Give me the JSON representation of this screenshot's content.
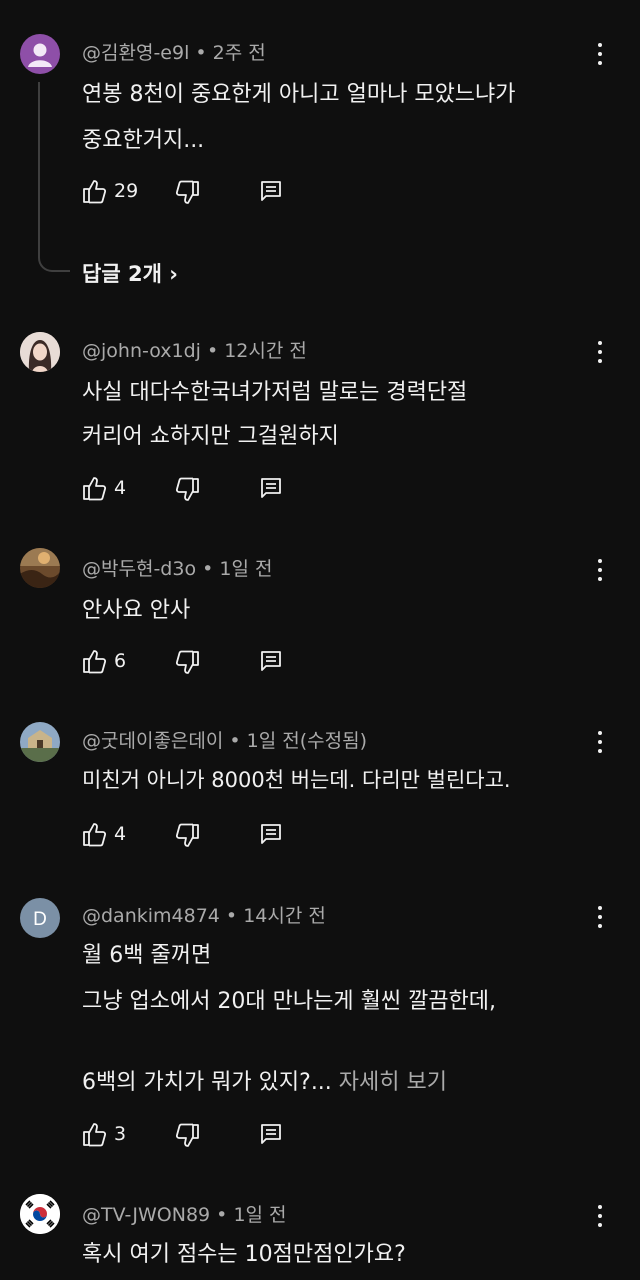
{
  "comments": [
    {
      "author": "@김환영-e9l",
      "time": "2주 전",
      "lines": [
        "연봉 8천이 중요한게 아니고 얼마나 모았느냐가",
        "중요한거지..."
      ],
      "likes": "29",
      "avatar": {
        "type": "default-person",
        "bg": "#8e4fa8"
      },
      "replies_label": "답글 2개 ›"
    },
    {
      "author": "@john-ox1dj",
      "time": "12시간 전",
      "lines": [
        "사실 대다수한국녀가저럼 말로는 경력단절",
        "커리어 쇼하지만 그걸원하지"
      ],
      "likes": "4",
      "avatar": {
        "type": "photo-portrait"
      }
    },
    {
      "author": "@박두현-d3o",
      "time": "1일 전",
      "lines": [
        "안사요  안사"
      ],
      "likes": "6",
      "avatar": {
        "type": "photo-landscape"
      }
    },
    {
      "author": "@굿데이좋은데이",
      "time": "1일 전(수정됨)",
      "lines": [
        "미친거 아니가 8000천 버는데. 다리만 벌린다고."
      ],
      "likes": "4",
      "avatar": {
        "type": "photo-building"
      }
    },
    {
      "author": "@dankim4874",
      "time": "14시간 전",
      "lines": [
        "월 6백 줄꺼면",
        "그냥 업소에서 20대 만나는게 훨씬 깔끔한데,",
        "6백의 가치가 뭐가 있지?..."
      ],
      "more_label": "자세히 보기",
      "likes": "3",
      "avatar": {
        "type": "letter",
        "letter": "D",
        "bg": "#7b90a6"
      }
    },
    {
      "author": "@TV-JWON89",
      "time": "1일 전",
      "lines": [
        "혹시 여기 점수는 10점만점인가요?"
      ],
      "avatar": {
        "type": "korea-flag"
      }
    }
  ],
  "separator": " • "
}
